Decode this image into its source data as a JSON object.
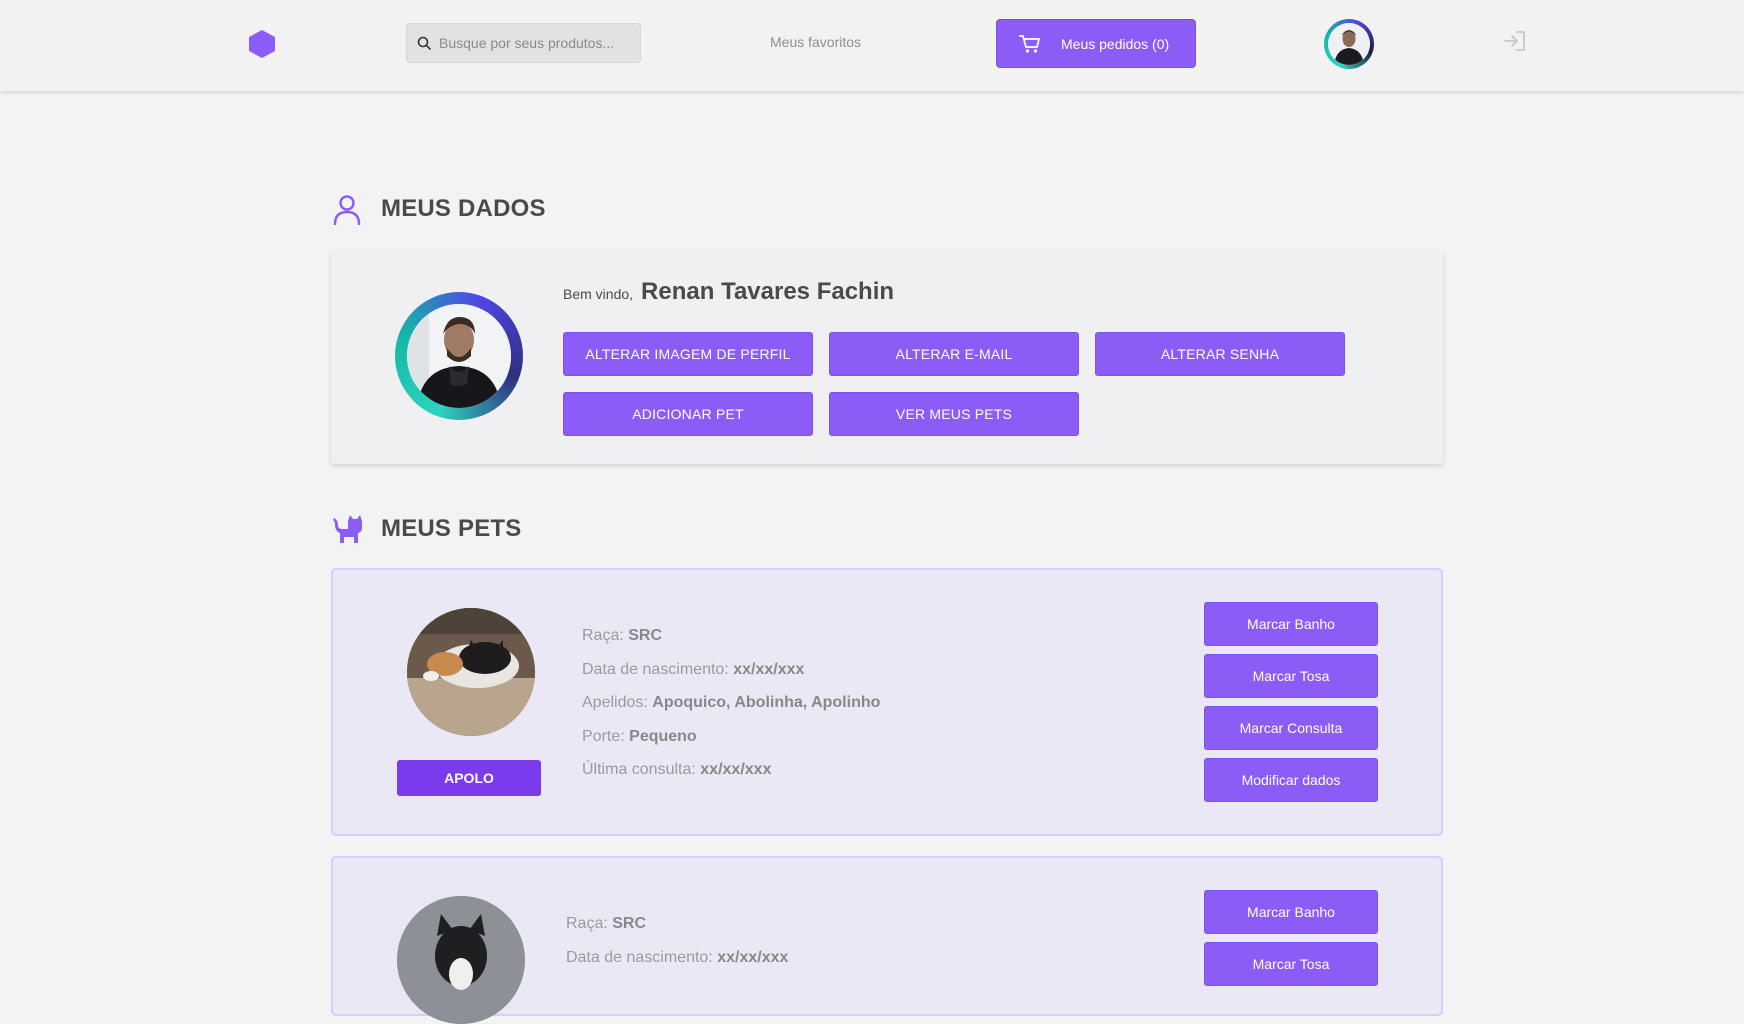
{
  "header": {
    "search_placeholder": "Busque por seus produtos...",
    "favorites_label": "Meus favoritos",
    "orders_label": "Meus pedidos (0)"
  },
  "colors": {
    "accent": "#8b5cf6",
    "accent_dark": "#7c3aed",
    "pet_card_bg": "#ebe8f5",
    "teal": "#2dd4bf"
  },
  "icons": {
    "logo": "hexagon-logo-icon",
    "search": "search-icon",
    "cart": "cart-icon",
    "logout": "logout-icon",
    "user_section": "user-icon",
    "pets_section": "cat-icon"
  },
  "profile": {
    "section_title": "MEUS DADOS",
    "welcome": "Bem vindo,",
    "name": "Renan Tavares Fachin",
    "buttons": [
      "ALTERAR IMAGEM DE PERFIL",
      "ALTERAR E-MAIL",
      "ALTERAR SENHA",
      "ADICIONAR PET",
      "VER MEUS PETS"
    ]
  },
  "pets_section": {
    "title": "MEUS PETS",
    "actions": [
      "Marcar Banho",
      "Marcar Tosa",
      "Marcar Consulta",
      "Modificar dados"
    ]
  },
  "pets": [
    {
      "name": "APOLO",
      "fields": [
        {
          "label": "Raça:",
          "value": "SRC"
        },
        {
          "label": "Data de nascimento:",
          "value": "xx/xx/xxx"
        },
        {
          "label": "Apelidos:",
          "value": "Apoquico, Abolinha, Apolinho"
        },
        {
          "label": "Porte:",
          "value": "Pequeno"
        },
        {
          "label": "Última consulta:",
          "value": "xx/xx/xxx"
        }
      ]
    },
    {
      "fields": [
        {
          "label": "Raça:",
          "value": "SRC"
        },
        {
          "label": "Data de nascimento:",
          "value": "xx/xx/xxx"
        }
      ]
    }
  ]
}
